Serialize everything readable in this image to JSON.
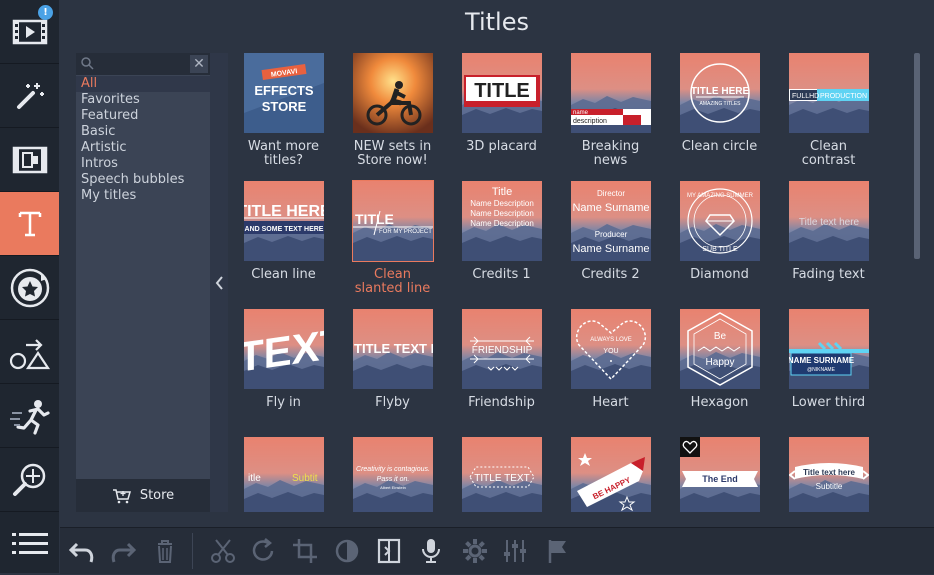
{
  "app": {
    "title": "Titles"
  },
  "sidebar": {
    "badge": "!",
    "items": [
      {
        "icon": "film-import-icon",
        "label": "Import"
      },
      {
        "icon": "magic-wand-icon",
        "label": "Filters"
      },
      {
        "icon": "transition-icon",
        "label": "Transitions"
      },
      {
        "icon": "title-t-icon",
        "label": "Titles",
        "active": true
      },
      {
        "icon": "sticker-star-icon",
        "label": "Stickers"
      },
      {
        "icon": "shapes-icon",
        "label": "Callouts"
      },
      {
        "icon": "running-man-icon",
        "label": "Motion"
      },
      {
        "icon": "zoom-pan-icon",
        "label": "Pan and Zoom"
      },
      {
        "icon": "menu-list-icon",
        "label": "More tools"
      }
    ]
  },
  "categories": {
    "search_placeholder": "",
    "items": [
      "All",
      "Favorites",
      "Featured",
      "Basic",
      "Artistic",
      "Intros",
      "Speech bubbles",
      "My titles"
    ],
    "active_index": 0,
    "store_label": "Store"
  },
  "titles": {
    "items": [
      {
        "label": "Want more\ntitles?",
        "thumb_text": "MOVAVI|EFFECTS|STORE"
      },
      {
        "label": "NEW sets in\nStore now!",
        "thumb_text": ""
      },
      {
        "label": "3D placard",
        "thumb_text": "TITLE"
      },
      {
        "label": "Breaking\nnews",
        "thumb_text": "name|description"
      },
      {
        "label": "Clean circle",
        "thumb_text": "TITLE HERE|AMAZING TITLES"
      },
      {
        "label": "Clean\ncontrast",
        "thumb_text": "FULLHD|PRODUCTION"
      },
      {
        "label": "Clean line",
        "thumb_text": "TITLE HERE|AND SOME TEXT HERE"
      },
      {
        "label": "Clean\nslanted line",
        "thumb_text": "TITLE|FOR MY PROJECT",
        "selected": true
      },
      {
        "label": "Credits 1",
        "thumb_text": "Title|Name Description|Name Description|Name Description"
      },
      {
        "label": "Credits 2",
        "thumb_text": "Director|Name Surname|Producer|Name Surname"
      },
      {
        "label": "Diamond",
        "thumb_text": "MY AMAZING SUMMER|SUB TITLE"
      },
      {
        "label": "Fading text",
        "thumb_text": "Title text here"
      },
      {
        "label": "Fly in",
        "thumb_text": "TEXT"
      },
      {
        "label": "Flyby",
        "thumb_text": "TITLE TEXT H"
      },
      {
        "label": "Friendship",
        "thumb_text": "FRIENDSHIP"
      },
      {
        "label": "Heart",
        "thumb_text": "ALWAYS LOVE|YOU"
      },
      {
        "label": "Hexagon",
        "thumb_text": "Be|Happy"
      },
      {
        "label": "Lower third",
        "thumb_text": "NAME SURNAME|@NIKNAME"
      },
      {
        "label": "",
        "thumb_text": "itle|Subtit"
      },
      {
        "label": "",
        "thumb_text": "Creativity is contagious.|Pass it on.|Albert Einstein"
      },
      {
        "label": "",
        "thumb_text": "TITLE TEXT"
      },
      {
        "label": "",
        "thumb_text": "BE HAPPY"
      },
      {
        "label": "",
        "thumb_text": "The End"
      },
      {
        "label": "",
        "thumb_text": "Title text here|Subtitle"
      }
    ]
  },
  "toolbar": {
    "buttons": [
      "undo-icon",
      "redo-icon",
      "trash-icon",
      "scissors-icon",
      "rotate-icon",
      "crop-icon",
      "color-adjust-icon",
      "clip-properties-icon",
      "microphone-icon",
      "gear-icon",
      "equalizer-icon",
      "flag-icon"
    ]
  },
  "colors": {
    "accent": "#ea7a5e",
    "background": "#2c3442",
    "sidebar": "#1f2630",
    "panel": "#3b4455"
  }
}
